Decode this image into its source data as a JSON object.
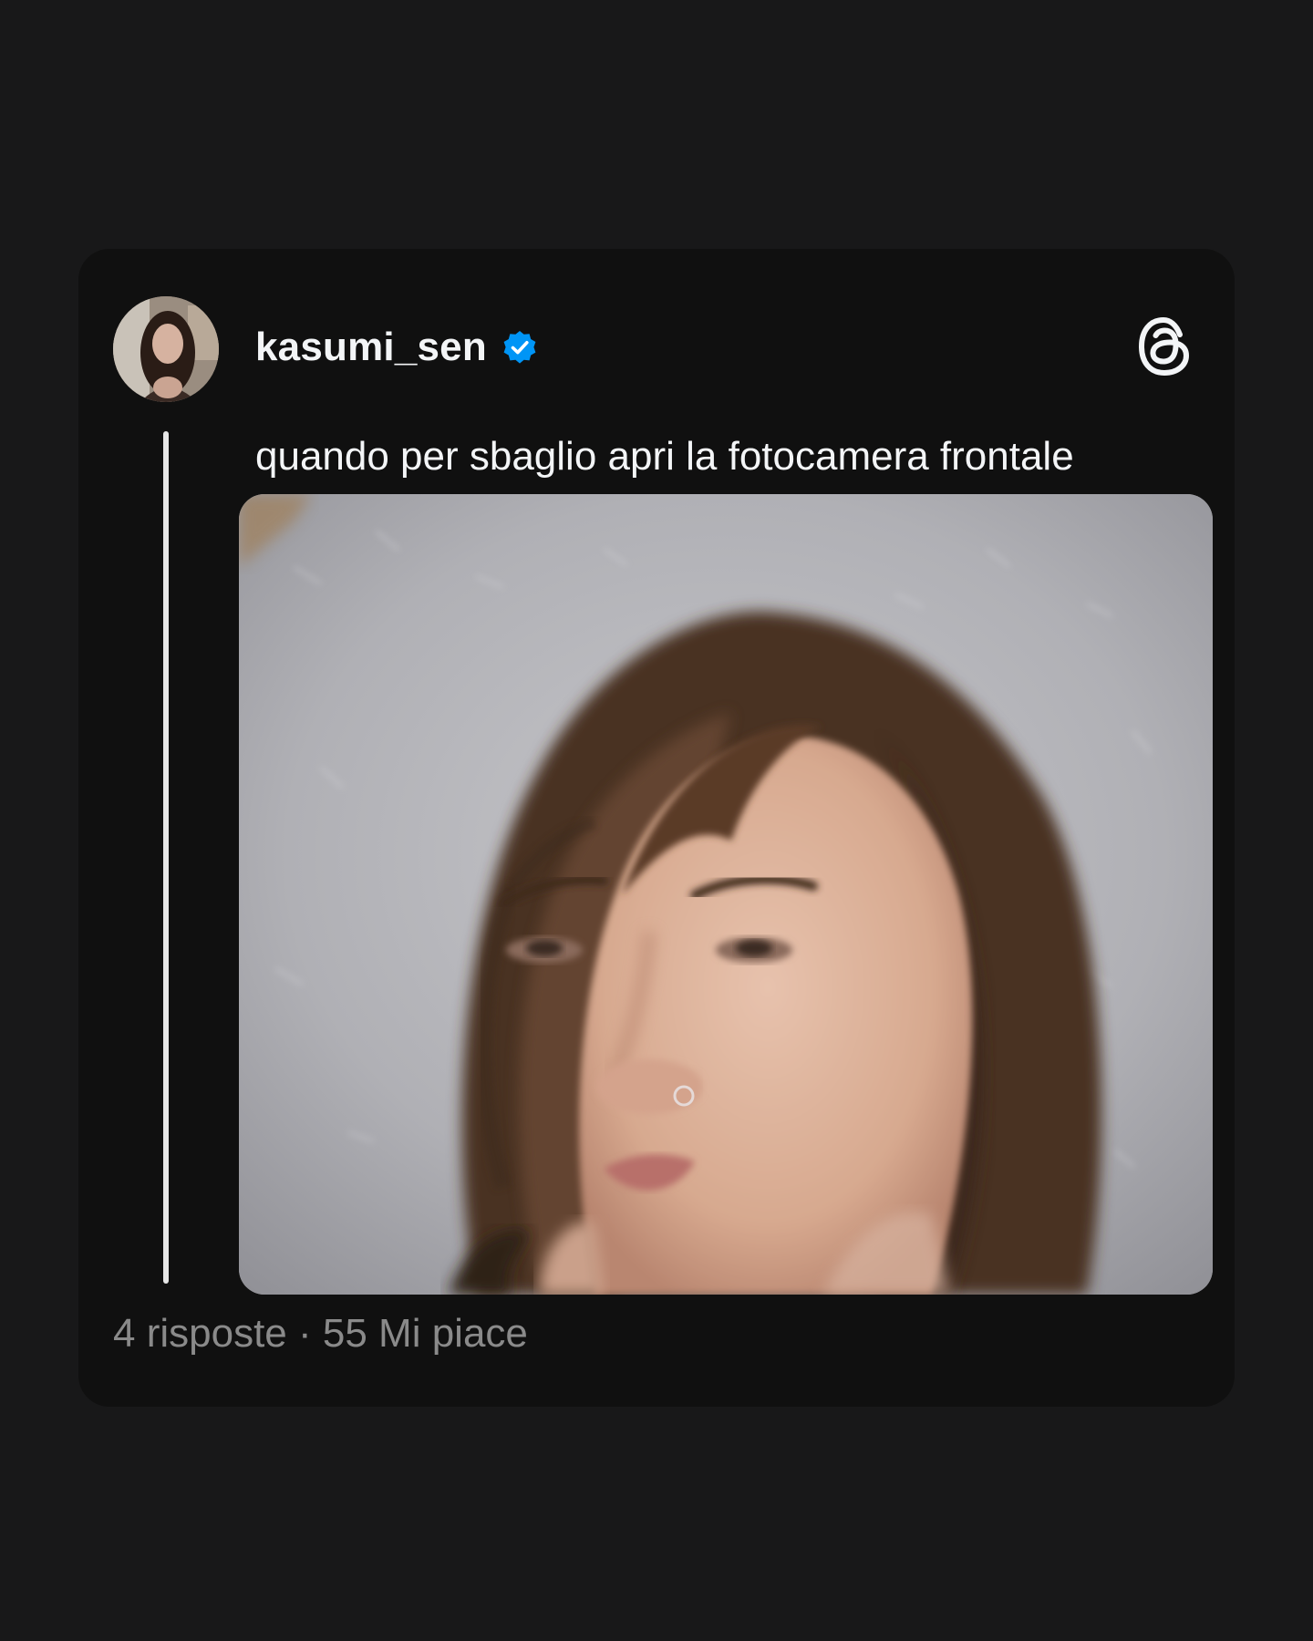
{
  "post": {
    "author": {
      "username": "kasumi_sen",
      "verified": true,
      "avatar": "avatar-photo"
    },
    "text": "quando per sbaglio apri la fotocamera frontale",
    "image": "selfie-photo",
    "stats": {
      "replies": "4 risposte",
      "separator": "·",
      "likes": "55 Mi piace"
    }
  },
  "icons": {
    "verified": "verified-badge-icon",
    "brand": "threads-logo-icon"
  },
  "colors": {
    "background": "#181819",
    "card": "#101010",
    "text": "#f3f5f7",
    "muted": "#8a8a8a",
    "verified": "#0095f6"
  }
}
